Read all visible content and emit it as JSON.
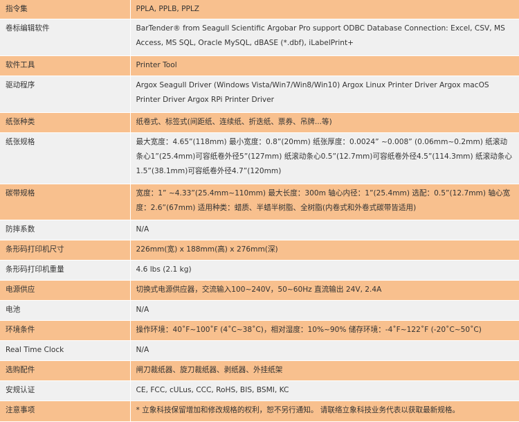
{
  "rows": [
    {
      "label": "指令集",
      "value": "PPLA, PPLB, PPLZ"
    },
    {
      "label": "卷标编辑软件",
      "value": "BarTender® from Seagull Scientific Argobar Pro support ODBC Database Connection: Excel, CSV, MS Access, MS SQL, Oracle MySQL, dBASE (*.dbf), iLabelPrint+"
    },
    {
      "label": "软件工具",
      "value": "Printer Tool"
    },
    {
      "label": "驱动程序",
      "value": "Argox Seagull Driver (Windows Vista/Win7/Win8/Win10) Argox Linux Printer Driver Argox macOS Printer Driver Argox RPi Printer Driver"
    },
    {
      "label": "纸张种类",
      "value": "纸卷式、标签式(间距纸、连续纸、折迭纸、票券、吊牌...等)"
    },
    {
      "label": "纸张规格",
      "value": "最大宽度：4.65”(118mm) 最小宽度：0.8”(20mm) 纸张厚度：0.0024” ~0.008” (0.06mm~0.2mm) 纸滚动条心1”(25.4mm)可容纸卷外径5”(127mm) 纸滚动条心0.5”(12.7mm)可容纸卷外径4.5”(114.3mm) 纸滚动条心1.5”(38.1mm)可容纸卷外径4.7”(120mm)"
    },
    {
      "label": "碳带规格",
      "value": "宽度：1” ~4.33”(25.4mm~110mm) 最大长度：300m 轴心内径：1”(25.4mm) 选配：0.5”(12.7mm) 轴心宽度：2.6”(67mm) 适用种类：蜡质、半蜡半树脂、全树脂(内卷式和外卷式碳带皆适用)"
    },
    {
      "label": "防摔系数",
      "value": "N/A"
    },
    {
      "label": "条形码打印机尺寸",
      "value": "226mm(宽) x 188mm(高) x 276mm(深)"
    },
    {
      "label": "条形码打印机重量",
      "value": "4.6 lbs (2.1 kg)"
    },
    {
      "label": "电源供应",
      "value": "切换式电源供应器，交流输入100~240V，50~60Hz 直流输出 24V, 2.4A"
    },
    {
      "label": "电池",
      "value": "N/A"
    },
    {
      "label": "环境条件",
      "value": "操作环境：40˚F~100˚F (4˚C~38˚C)，相对湿度：10%~90% 储存环境：-4˚F~122˚F (-20˚C~50˚C)"
    },
    {
      "label": "Real Time Clock",
      "value": "N/A"
    },
    {
      "label": "选购配件",
      "value": "闸刀裁纸器、旋刀裁纸器、剥纸器、外挂纸架"
    },
    {
      "label": "安规认证",
      "value": "CE, FCC, cULus, CCC, RoHS, BIS, BSMI, KC"
    },
    {
      "label": "注意事项",
      "value": "* 立象科技保留增加和修改规格的权利，恕不另行通知。 请联络立象科技业务代表以获取最新规格。"
    }
  ]
}
